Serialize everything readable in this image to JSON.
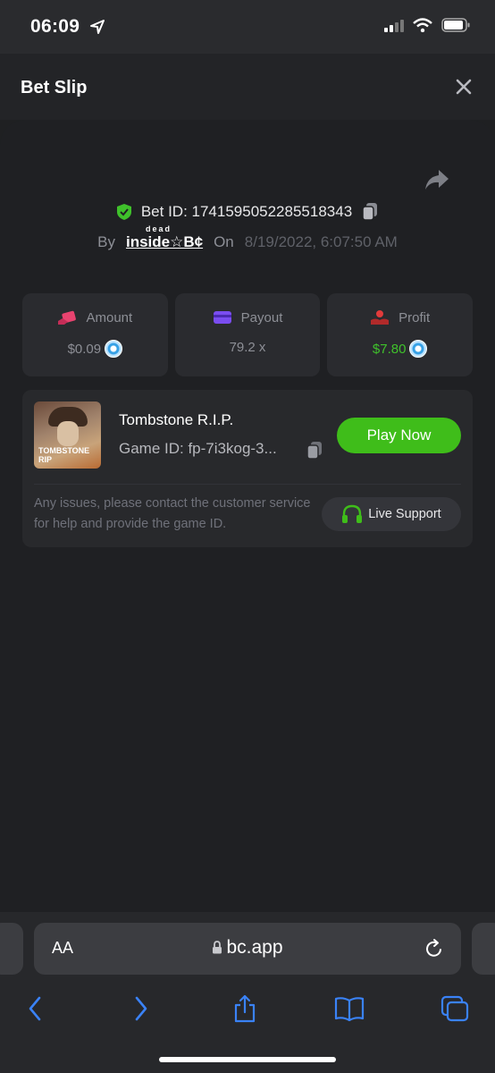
{
  "status_bar": {
    "time": "06:09"
  },
  "header": {
    "title": "Bet Slip"
  },
  "bet": {
    "id_label": "Bet ID: 1741595052285518343",
    "by_label": "By",
    "user_name": "inside☆B¢",
    "user_super": "dead",
    "on_label": "On",
    "date": "8/19/2022, 6:07:50 AM"
  },
  "stats": {
    "amount": {
      "label": "Amount",
      "value": "$0.09"
    },
    "payout": {
      "label": "Payout",
      "value": "79.2 x"
    },
    "profit": {
      "label": "Profit",
      "value": "$7.80"
    }
  },
  "game": {
    "thumb_text": "TOMBSTONE RIP",
    "name": "Tombstone R.I.P.",
    "id_label": "Game ID: fp-7i3kog-3...",
    "play_label": "Play Now",
    "issue_text": "Any issues, please contact the customer service for help and provide the game ID.",
    "support_label": "Live Support"
  },
  "browser": {
    "aa_label": "AA",
    "url": "bc.app"
  },
  "colors": {
    "accent_green": "#3fbd1a",
    "profit_green": "#3fc12b",
    "amount_icon": "#e8436f",
    "payout_icon": "#7a4df0",
    "profit_icon": "#e23b3b",
    "safari_blue": "#3a82f7"
  },
  "icons": {
    "status": [
      "location-arrow-icon",
      "signal-icon",
      "wifi-icon",
      "battery-icon"
    ],
    "header": [
      "close-icon"
    ],
    "panel": [
      "share-icon",
      "shield-check-icon",
      "copy-icon",
      "amount-icon",
      "payout-icon",
      "profit-icon",
      "coin-icon",
      "headset-icon"
    ],
    "safari": [
      "lock-icon",
      "reload-icon",
      "back-icon",
      "forward-icon",
      "share-icon",
      "bookmarks-icon",
      "tabs-icon"
    ]
  }
}
